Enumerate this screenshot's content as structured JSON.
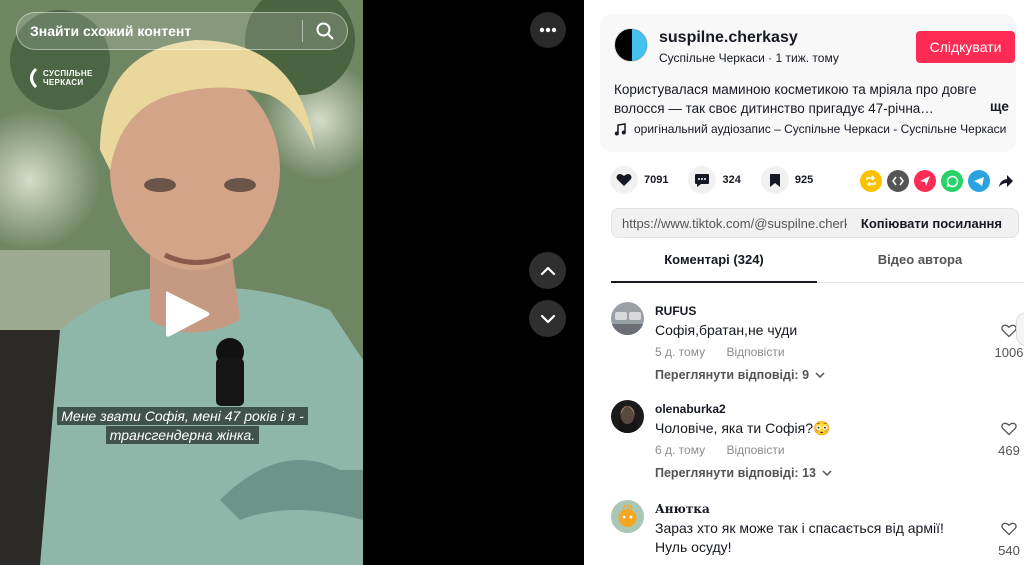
{
  "video": {
    "search_placeholder": "Знайти схожий контент",
    "logo_line1": "СУСПІЛЬНЕ",
    "logo_line2": "ЧЕРКАСИ",
    "subtitle_line1": "Мене звати Софія, мені 47 років і я -",
    "subtitle_line2": "трансгендерна жінка."
  },
  "author": {
    "username": "suspilne.cherkasy",
    "display_name": "Суспільне Черкаси",
    "posted": "1 тиж. тому",
    "follow_label": "Слідкувати",
    "description": "Користувалася маминою косметикою та мріяла про довге волосся — так своє дитинство пригадує 47-річна…",
    "more_label": "ще",
    "music": "оригінальний аудіозапис – Суспільне Черкаси - Суспільне Черкаси"
  },
  "stats": {
    "likes": "7091",
    "comments": "324",
    "saves": "925"
  },
  "share": {
    "url": "https://www.tiktok.com/@suspilne.cherk...",
    "copy_label": "Копіювати посилання"
  },
  "tabs": [
    {
      "label": "Коментарі (324)"
    },
    {
      "label": "Відео автора"
    }
  ],
  "comments": [
    {
      "user": "RUFUS",
      "text": "Софія,братан,не чуди",
      "time": "5 д. тому",
      "reply": "Відповісти",
      "view_replies": "Переглянути відповіді: 9",
      "likes": "1006"
    },
    {
      "user": "olenaburka2",
      "text": "Чоловіче, яка ти Софія?😳",
      "time": "6 д. тому",
      "reply": "Відповісти",
      "view_replies": "Переглянути відповіді: 13",
      "likes": "469"
    },
    {
      "user": "Анютка",
      "text": "Зараз хто як може так і спасається від армії! Нуль осуду!",
      "likes": "540"
    }
  ],
  "colors": {
    "accent": "#fe2c55",
    "panel_bg": "#ffffff",
    "card_bg": "#f8f8f8"
  }
}
